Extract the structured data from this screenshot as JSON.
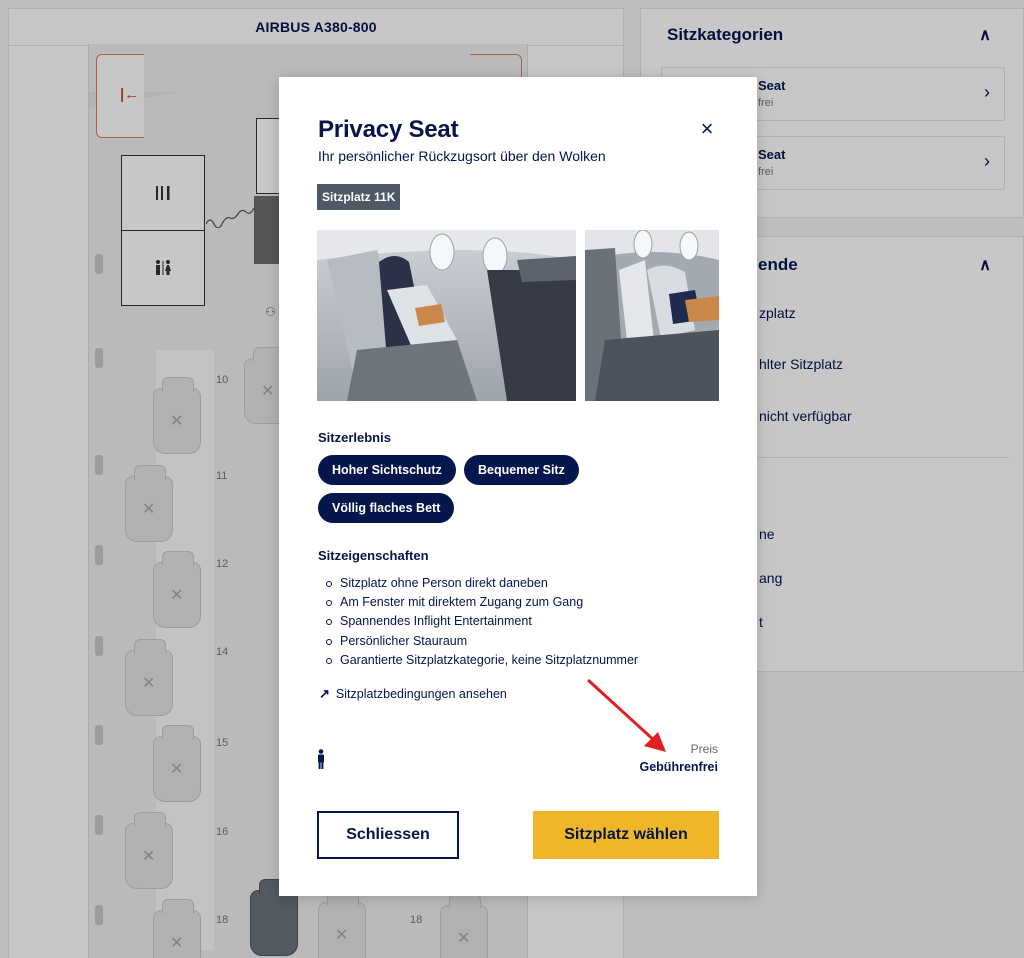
{
  "seatmap": {
    "aircraft": "AIRBUS A380-800",
    "row_numbers": [
      "10",
      "11",
      "12",
      "14",
      "15",
      "16",
      "18",
      "18"
    ],
    "facility_icons": [
      "galley-icon",
      "lavatory-icon",
      "exit-icon"
    ]
  },
  "sidebar": {
    "categories_title": "Sitzkategorien",
    "categories": [
      {
        "title": "Seat",
        "subtitle": "frei"
      },
      {
        "title": "Seat",
        "subtitle": "frei"
      }
    ],
    "legend_title": "ende",
    "legend_items": [
      "zplatz",
      "hlter Sitzplatz",
      "nicht verfügbar",
      "ne",
      "ang",
      "t"
    ]
  },
  "modal": {
    "title": "Privacy Seat",
    "subtitle": "Ihr persönlicher Rückzugsort über den Wolken",
    "seat_badge": "Sitzplatz 11K",
    "experience_title": "Sitzerlebnis",
    "chips": [
      "Hoher Sichtschutz",
      "Bequemer Sitz",
      "Völlig flaches Bett"
    ],
    "properties_title": "Sitzeigenschaften",
    "properties": [
      "Sitzplatz ohne Person direkt daneben",
      "Am Fenster mit direktem Zugang zum Gang",
      "Spannendes Inflight Entertainment",
      "Persönlicher Stauraum",
      "Garantierte Sitzplatzkategorie, keine Sitzplatznummer"
    ],
    "conditions_link": "Sitzplatzbedingungen ansehen",
    "price_label": "Preis",
    "price_value": "Gebührenfrei",
    "close_button": "Schliessen",
    "select_button": "Sitzplatz wählen",
    "close_icon": "×",
    "colors": {
      "navy": "#05164d",
      "yellow": "#efb627",
      "badge": "#4d5a65",
      "annotation": "#e02020"
    }
  }
}
